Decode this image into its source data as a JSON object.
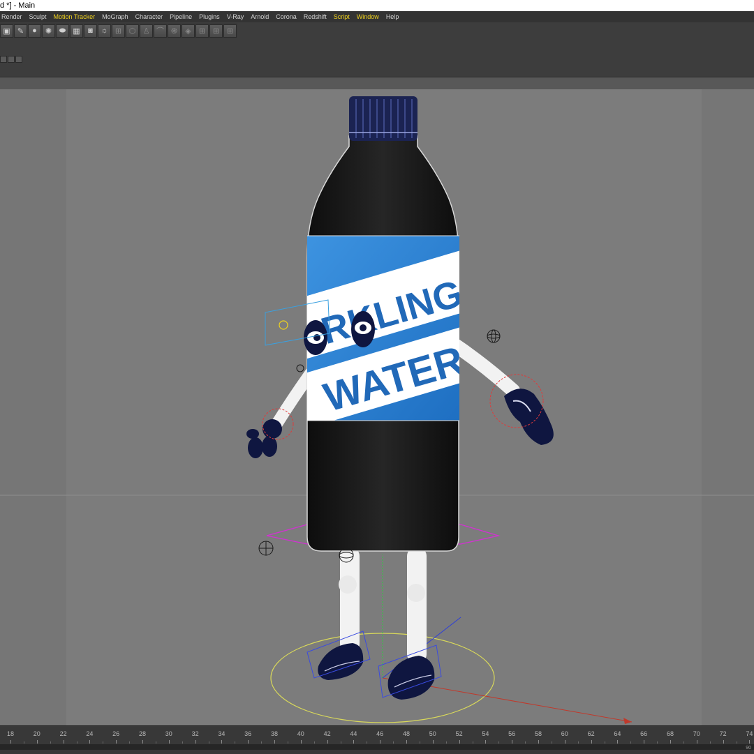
{
  "window": {
    "title": "d *] - Main"
  },
  "menu": [
    "Render",
    "Sculpt",
    "Motion Tracker",
    "MoGraph",
    "Character",
    "Pipeline",
    "Plugins",
    "V-Ray",
    "Arnold",
    "Corona",
    "Redshift",
    "Script",
    "Window",
    "Help"
  ],
  "menu_highlighted": [
    "Motion Tracker",
    "Script",
    "Window"
  ],
  "colors": {
    "menu_highlight": "#f0d21e",
    "viewport_bg": "#7c7c7c",
    "bottle_label": "#2b82d3",
    "bottle_body": "#1b1b1b",
    "cap": "#1b2352",
    "gloves": "#0f1640"
  },
  "toolbar_icons": [
    "cube-icon",
    "pen-icon",
    "sphere-icon",
    "gear-sphere-icon",
    "capsule-icon",
    "floor-icon",
    "camera-icon",
    "light-icon",
    "grid-icon",
    "cube-outline-icon",
    "figure-icon",
    "bend-icon",
    "spiral-icon",
    "deformer-icon",
    "grid2-icon",
    "grid3-icon",
    "grid4-icon"
  ],
  "label": {
    "line1": "RKLING",
    "line2": "WATER"
  },
  "timeline": {
    "ticks": [
      18,
      20,
      22,
      24,
      26,
      28,
      30,
      32,
      34,
      36,
      38,
      40,
      42,
      44,
      46,
      48,
      50,
      52,
      54,
      56,
      58,
      60,
      62,
      64,
      66,
      68,
      70,
      72,
      74
    ],
    "end_label": "90"
  }
}
